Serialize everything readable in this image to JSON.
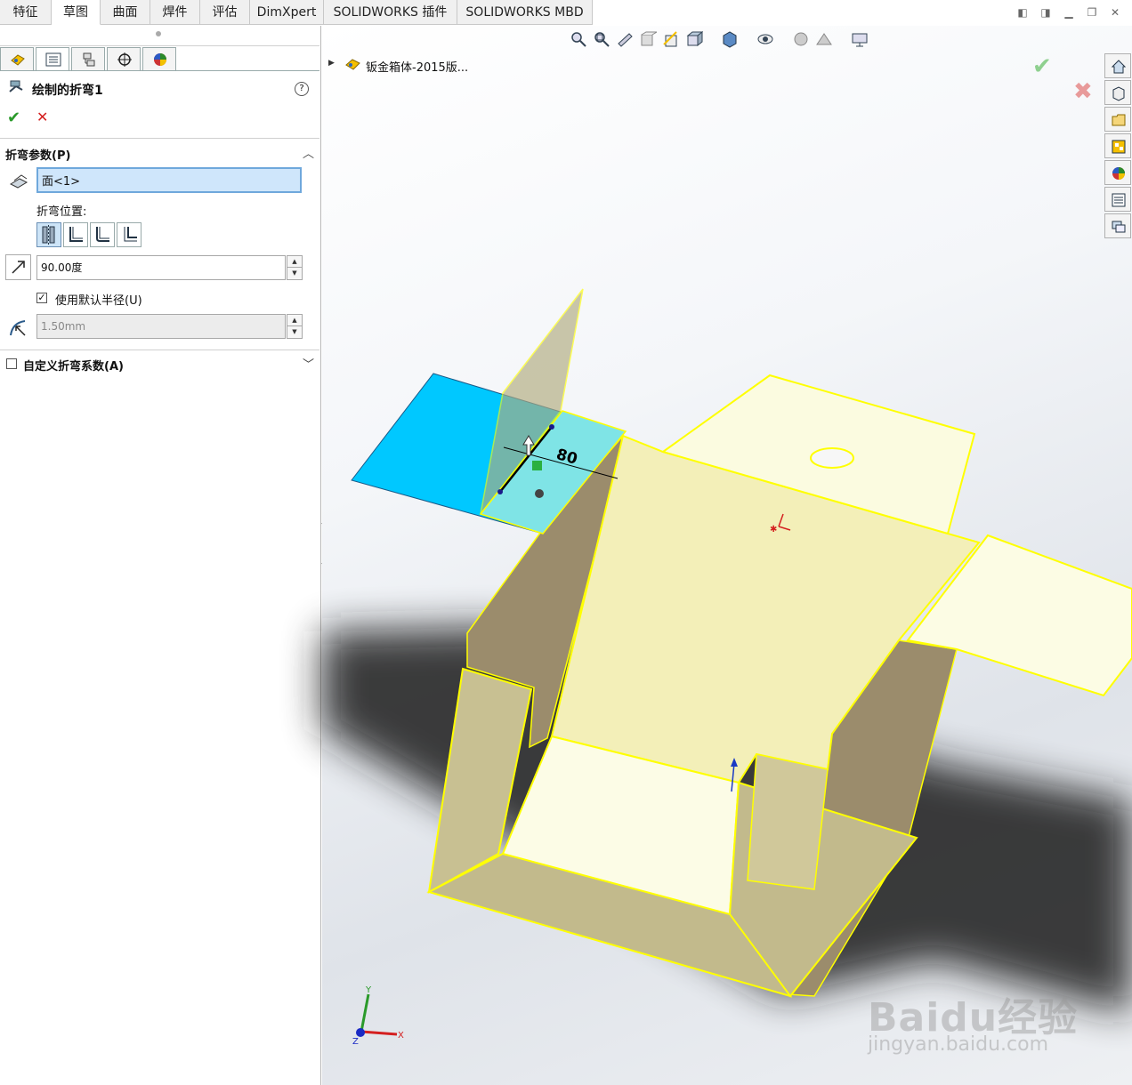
{
  "tabs": [
    "特征",
    "草图",
    "曲面",
    "焊件",
    "评估",
    "DimXpert",
    "SOLIDWORKS 插件",
    "SOLIDWORKS MBD"
  ],
  "active_tab": "草图",
  "panel": {
    "title": "绘制的折弯1",
    "help": "?",
    "section_bend_params": "折弯参数(P)",
    "face_value": "面<1>",
    "bend_position_label": "折弯位置:",
    "angle_value": "90.00度",
    "use_default_radius_label": "使用默认半径(U)",
    "use_default_radius_checked": true,
    "radius_value": "1.50mm",
    "custom_bend_allowance_label": "自定义折弯系数(A)",
    "custom_bend_allowance_checked": false
  },
  "tree": {
    "root_label": "钣金箱体-2015版..."
  },
  "dimension_label": "80",
  "axis": {
    "x": "X",
    "y": "Y",
    "z": "Z"
  },
  "watermark": {
    "brand": "Baidu经验",
    "url": "jingyan.baidu.com"
  },
  "colors": {
    "accent": "#1f6fc5",
    "face_selected": "#00c8ff",
    "edge_highlight": "#ffff00",
    "confirm": "#2a9a2a",
    "cancel": "#d42020"
  }
}
